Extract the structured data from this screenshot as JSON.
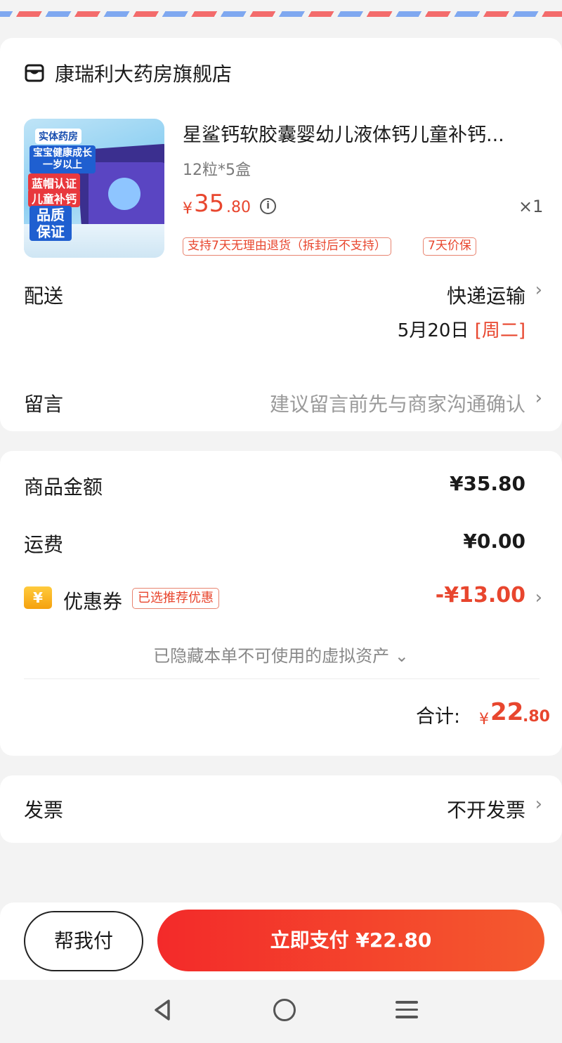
{
  "store": {
    "name": "康瑞利大药房旗舰店",
    "icon": "store-icon"
  },
  "product": {
    "image_tags": [
      "实体药房",
      "宝宝健康成长\n一岁以上",
      "蓝帽认证",
      "儿童补钙",
      "品质\n保证"
    ],
    "title": "星鲨钙软胶囊婴幼儿液体钙儿童补钙...",
    "spec": "12粒*5盒",
    "price_symbol": "¥",
    "price_int": "35",
    "price_dec": ".80",
    "quantity": "×1",
    "badges": [
      "支持7天无理由退货（拆封后不支持）",
      "7天价保"
    ]
  },
  "delivery": {
    "label": "配送",
    "method": "快递运输",
    "date": "5月20日",
    "weekday": "[周二]"
  },
  "message": {
    "label": "留言",
    "placeholder": "建议留言前先与商家沟通确认"
  },
  "summary": {
    "goods_label": "商品金额",
    "goods_value": "¥35.80",
    "shipping_label": "运费",
    "shipping_value": "¥0.00",
    "coupon_label": "优惠券",
    "coupon_icon_text": "¥",
    "coupon_tag": "已选推荐优惠",
    "coupon_value": "-¥13.00",
    "hidden_assets": "已隐藏本单不可使用的虚拟资产",
    "total_label": "合计:",
    "total_symbol": "¥",
    "total_int": "22",
    "total_dec": ".80"
  },
  "invoice": {
    "label": "发票",
    "value": "不开发票"
  },
  "actions": {
    "help_pay": "帮我付",
    "pay_now": "立即支付 ¥22.80"
  },
  "colors": {
    "accent": "#e8462e",
    "pay_gradient_start": "#f32a2a",
    "pay_gradient_end": "#f45a2e"
  },
  "chevron": "›",
  "chevron_down": "⌄"
}
